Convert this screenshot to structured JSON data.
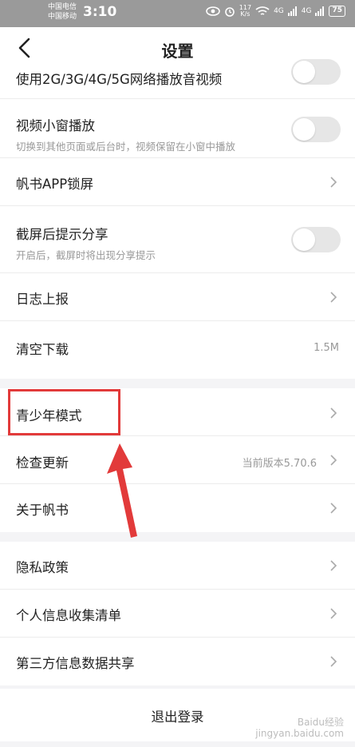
{
  "status_bar": {
    "carrier_1": "中国电信",
    "carrier_2": "中国移动",
    "time": "3:10",
    "net_speed": "117",
    "net_unit": "K/s",
    "signal_label": "4G",
    "battery": "75"
  },
  "header": {
    "title": "设置"
  },
  "settings": {
    "mobile_data_play": {
      "label": "使用2G/3G/4G/5G网络播放音视频",
      "on": false
    },
    "mini_window": {
      "label": "视频小窗播放",
      "desc": "切换到其他页面或后台时，视频保留在小窗中播放",
      "on": false
    },
    "app_lock": {
      "label": "帆书APP锁屏"
    },
    "screenshot_share": {
      "label": "截屏后提示分享",
      "desc": "开启后，截屏时将出现分享提示",
      "on": false
    },
    "log_report": {
      "label": "日志上报"
    },
    "clear_downloads": {
      "label": "清空下载",
      "value": "1.5M"
    },
    "teen_mode": {
      "label": "青少年模式"
    },
    "check_update": {
      "label": "检查更新",
      "value": "当前版本5.70.6"
    },
    "about": {
      "label": "关于帆书"
    },
    "privacy": {
      "label": "隐私政策"
    },
    "personal_info": {
      "label": "个人信息收集清单"
    },
    "third_party": {
      "label": "第三方信息数据共享"
    }
  },
  "logout": {
    "label": "退出登录"
  },
  "watermark": {
    "line1": "Baidu经验",
    "line2": "jingyan.baidu.com"
  },
  "colors": {
    "highlight": "#e23a3a",
    "background": "#f4f4f6"
  }
}
